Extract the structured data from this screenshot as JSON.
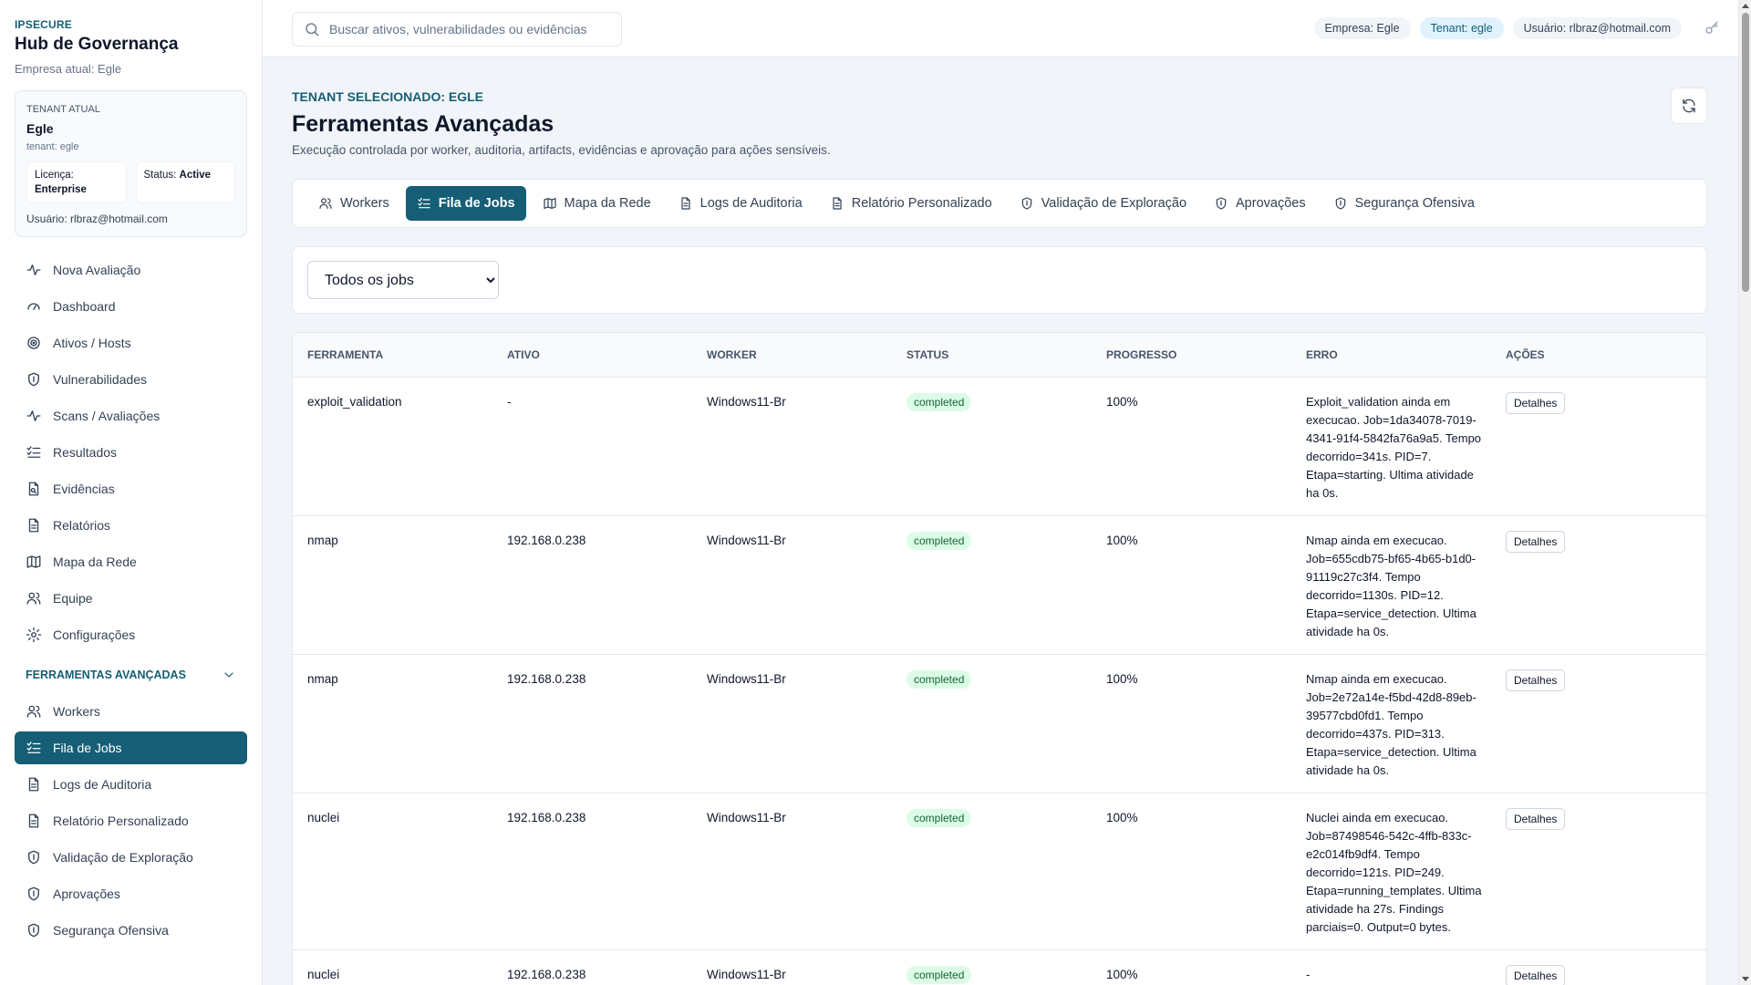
{
  "brand": {
    "small": "IPSECURE",
    "title": "Hub de Governança",
    "company": "Empresa atual: Egle"
  },
  "tenant_card": {
    "label": "TENANT ATUAL",
    "name": "Egle",
    "slug": "tenant: egle",
    "license_label": "Licença:",
    "license_value": "Enterprise",
    "status_label": "Status:",
    "status_value": "Active",
    "user": "Usuário: rlbraz@hotmail.com"
  },
  "nav": {
    "items": [
      {
        "label": "Nova Avaliação",
        "icon": "activity-icon"
      },
      {
        "label": "Dashboard",
        "icon": "gauge-icon"
      },
      {
        "label": "Ativos / Hosts",
        "icon": "target-icon"
      },
      {
        "label": "Vulnerabilidades",
        "icon": "shield-icon"
      },
      {
        "label": "Scans / Avaliações",
        "icon": "activity-icon"
      },
      {
        "label": "Resultados",
        "icon": "list-check-icon"
      },
      {
        "label": "Evidências",
        "icon": "file-icon"
      },
      {
        "label": "Relatórios",
        "icon": "file-text-icon"
      },
      {
        "label": "Mapa da Rede",
        "icon": "map-icon"
      },
      {
        "label": "Equipe",
        "icon": "users-icon"
      },
      {
        "label": "Configurações",
        "icon": "gear-icon"
      }
    ],
    "section_label": "FERRAMENTAS AVANÇADAS",
    "section_items": [
      {
        "label": "Workers",
        "icon": "users-icon"
      },
      {
        "label": "Fila de Jobs",
        "icon": "list-check-icon",
        "active": true
      },
      {
        "label": "Logs de Auditoria",
        "icon": "file-text-icon"
      },
      {
        "label": "Relatório Personalizado",
        "icon": "file-text-icon"
      },
      {
        "label": "Validação de Exploração",
        "icon": "shield-icon"
      },
      {
        "label": "Aprovações",
        "icon": "shield-icon"
      },
      {
        "label": "Segurança Ofensiva",
        "icon": "shield-icon"
      }
    ]
  },
  "topbar": {
    "search_placeholder": "Buscar ativos, vulnerabilidades ou evidências",
    "pill_company": "Empresa: Egle",
    "pill_tenant": "Tenant: egle",
    "pill_user": "Usuário: rlbraz@hotmail.com"
  },
  "header": {
    "eyebrow": "TENANT SELECIONADO: EGLE",
    "title": "Ferramentas Avançadas",
    "subtitle": "Execução controlada por worker, auditoria, artifacts, evidências e aprovação para ações sensíveis."
  },
  "tabs": [
    {
      "label": "Workers",
      "icon": "users-icon"
    },
    {
      "label": "Fila de Jobs",
      "icon": "list-check-icon",
      "active": true
    },
    {
      "label": "Mapa da Rede",
      "icon": "map-icon"
    },
    {
      "label": "Logs de Auditoria",
      "icon": "file-text-icon"
    },
    {
      "label": "Relatório Personalizado",
      "icon": "file-text-icon"
    },
    {
      "label": "Validação de Exploração",
      "icon": "shield-icon"
    },
    {
      "label": "Aprovações",
      "icon": "shield-icon"
    },
    {
      "label": "Segurança Ofensiva",
      "icon": "shield-icon"
    }
  ],
  "filter": {
    "selected": "Todos os jobs"
  },
  "table": {
    "headers": [
      "FERRAMENTA",
      "ATIVO",
      "WORKER",
      "STATUS",
      "PROGRESSO",
      "ERRO",
      "AÇÕES"
    ],
    "action_label": "Detalhes",
    "rows": [
      {
        "tool": "exploit_validation",
        "asset": "-",
        "worker": "Windows11-Br",
        "status": "completed",
        "progress": "100%",
        "error": "Exploit_validation ainda em execucao. Job=1da34078-7019-4341-91f4-5842fa76a9a5. Tempo decorrido=341s. PID=7. Etapa=starting. Ultima atividade ha 0s."
      },
      {
        "tool": "nmap",
        "asset": "192.168.0.238",
        "worker": "Windows11-Br",
        "status": "completed",
        "progress": "100%",
        "error": "Nmap ainda em execucao. Job=655cdb75-bf65-4b65-b1d0-91119c27c3f4. Tempo decorrido=1130s. PID=12. Etapa=service_detection. Ultima atividade ha 0s."
      },
      {
        "tool": "nmap",
        "asset": "192.168.0.238",
        "worker": "Windows11-Br",
        "status": "completed",
        "progress": "100%",
        "error": "Nmap ainda em execucao. Job=2e72a14e-f5bd-42d8-89eb-39577cbd0fd1. Tempo decorrido=437s. PID=313. Etapa=service_detection. Ultima atividade ha 0s."
      },
      {
        "tool": "nuclei",
        "asset": "192.168.0.238",
        "worker": "Windows11-Br",
        "status": "completed",
        "progress": "100%",
        "error": "Nuclei ainda em execucao. Job=87498546-542c-4ffb-833c-e2c014fb9df4. Tempo decorrido=121s. PID=249. Etapa=running_templates. Ultima atividade ha 27s. Findings parciais=0. Output=0 bytes."
      },
      {
        "tool": "nuclei",
        "asset": "192.168.0.238",
        "worker": "Windows11-Br",
        "status": "completed",
        "progress": "100%",
        "error": "-"
      }
    ]
  },
  "colors": {
    "accent": "#155e75",
    "badge_bg": "#dcfce7",
    "badge_text": "#166534"
  }
}
